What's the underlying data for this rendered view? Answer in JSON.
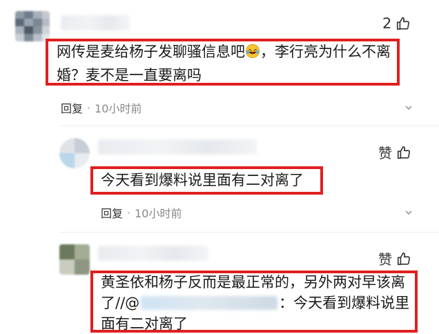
{
  "comments": [
    {
      "like_count": "2",
      "text_lines": [
        "网传是麦给杨子发聊骚信息吧",
        "，李行亮为什么不离",
        "婚？麦不是一直要离吗"
      ],
      "reply_label": "回复",
      "separator": "·",
      "time": "10小时前"
    },
    {
      "like_label": "赞",
      "text": "今天看到爆料说里面有二对离了",
      "reply_label": "回复",
      "separator": "·",
      "time": "10小时前"
    },
    {
      "like_label": "赞",
      "text_lines": [
        "黄圣依和杨子反而是最正常的，另外两对早该离",
        "了//@",
        "：今天看到爆料说里",
        "面有二对离了"
      ]
    }
  ],
  "icons": {
    "like": "thumbs-up-icon",
    "expand": "chevron-down-icon",
    "emoji": "laughing-crying-emoji"
  },
  "colors": {
    "highlight_border": "#e01f1f",
    "text": "#1a1a1a",
    "meta": "#888888"
  }
}
